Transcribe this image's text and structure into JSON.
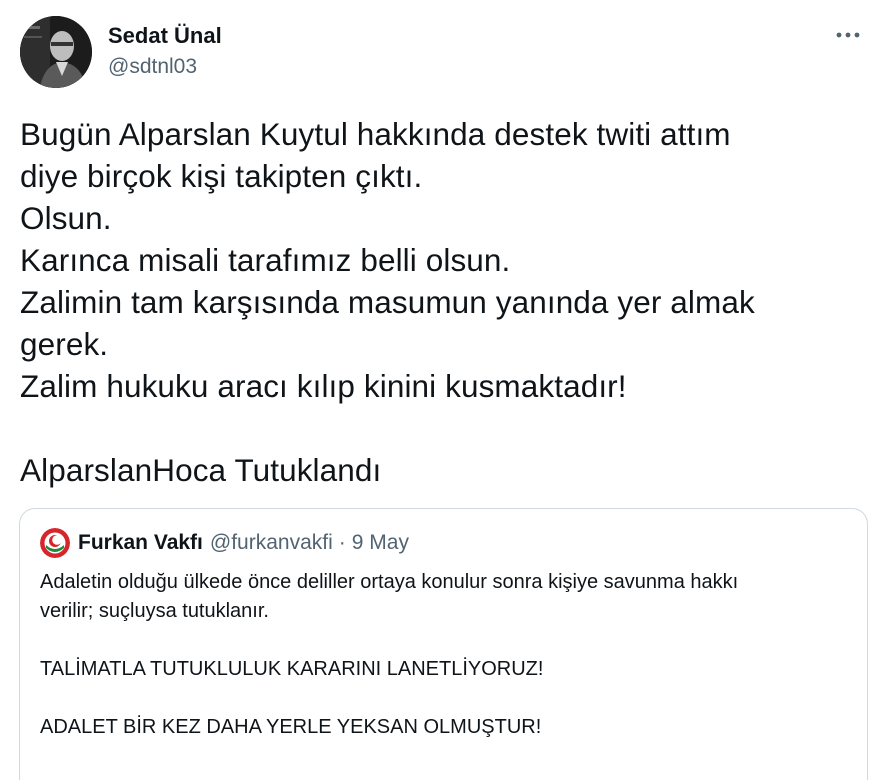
{
  "author": {
    "display_name": "Sedat Ünal",
    "handle": "@sdtnl03"
  },
  "more_icon": "more-horizontal-icon",
  "tweet": {
    "lines": [
      "Bugün Alparslan Kuytul hakkında destek twiti attım",
      "diye birçok kişi takipten çıktı.",
      "Olsun.",
      "Karınca misali tarafımız belli olsun.",
      "Zalimin tam karşısında masumun yanında yer almak",
      "gerek.",
      "Zalim hukuku aracı kılıp kinini kusmaktadır!",
      "AlparslanHoca Tutuklandı"
    ]
  },
  "quote": {
    "display_name": "Furkan Vakfı",
    "handle": "@furkanvakfi",
    "separator": "·",
    "date": "9 May",
    "avatar_icon": "furkan-vakfi-logo",
    "lines": [
      "Adaletin olduğu ülkede önce deliller ortaya konulur sonra kişiye savunma hakkı",
      "verilir; suçluysa tutuklanır.",
      "TALİMATLA TUTUKLULUK KARARINI LANETLİYORUZ!",
      "ADALET BİR KEZ DAHA YERLE YEKSAN OLMUŞTUR!"
    ]
  },
  "colors": {
    "text": "#0f1419",
    "secondary": "#536471",
    "border": "#cfd9de",
    "logo_red": "#d7262b",
    "logo_green": "#1f8a3b"
  }
}
